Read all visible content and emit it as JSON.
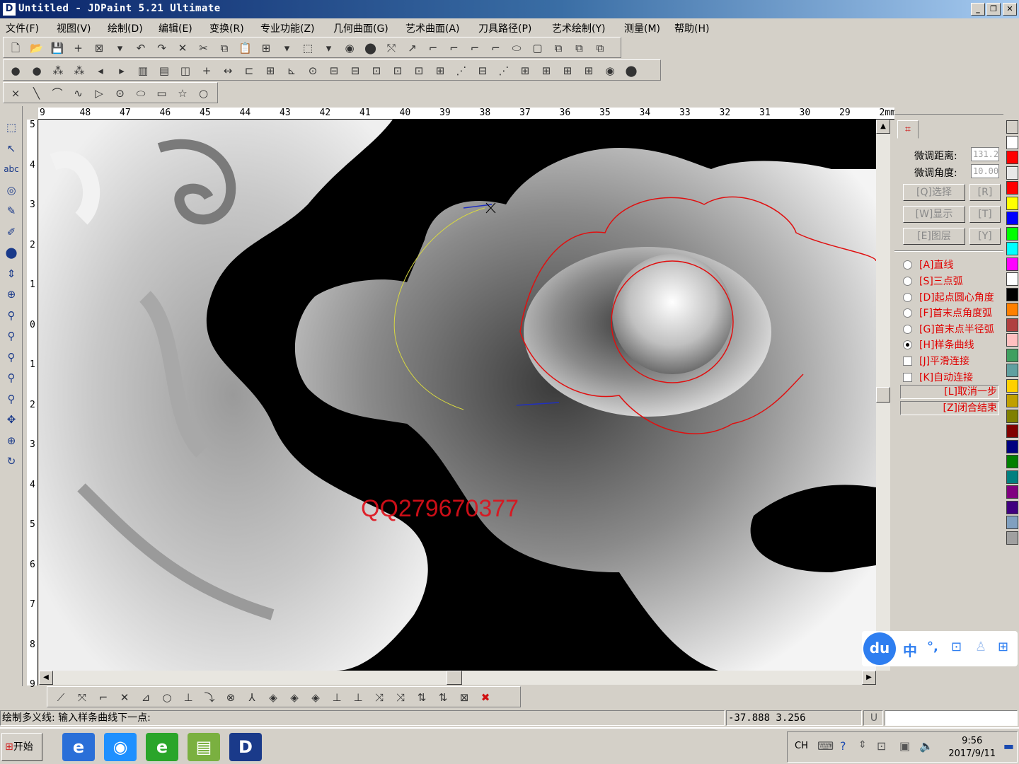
{
  "window": {
    "title": "Untitled - JDPaint 5.21 Ultimate",
    "app_icon": "jdpaint-logo-icon",
    "controls": [
      "minimize-icon",
      "restore-icon",
      "close-icon"
    ],
    "minimize": "_",
    "restore": "❐",
    "close": "✕"
  },
  "menu": [
    "文件(F)",
    "视图(V)",
    "绘制(D)",
    "编辑(E)",
    "变换(R)",
    "专业功能(Z)",
    "几何曲面(G)",
    "艺术曲面(A)",
    "刀具路径(P)",
    "艺术绘制(Y)",
    "测量(M)",
    "帮助(H)"
  ],
  "toolbar1": [
    "🗋",
    "📂",
    "💾",
    "+",
    "⊠",
    "▾",
    "↶",
    "↷",
    "✕",
    "✂",
    "⧉",
    "📋",
    "⊞",
    "▾",
    "⬚",
    "▾",
    "◉",
    "⬤",
    "⤲",
    "↗",
    "⌐",
    "⌐",
    "⌐",
    "⌐",
    "⬭",
    "▢",
    "⧉",
    "⧉",
    "⧉"
  ],
  "toolbar2": [
    "●",
    "●",
    "⁂",
    "⁂",
    "◂",
    "▸",
    "▥",
    "▤",
    "◫",
    "+",
    "↔",
    "⊏",
    "⊞",
    "⊾",
    "⊙",
    "⊟",
    "⊟",
    "⊡",
    "⊡",
    "⊡",
    "⊞",
    "⋰",
    "⊟",
    "⋰",
    "⊞",
    "⊞",
    "⊞",
    "⊞",
    "◉",
    "⬤"
  ],
  "toolbar3": [
    "×",
    "╲",
    "⌒",
    "∿",
    "▷",
    "⊙",
    "⬭",
    "▭",
    "☆",
    "○"
  ],
  "left_tools": [
    "⬚",
    "↖",
    "abc",
    "◎",
    "✎",
    "✐",
    "⬤",
    "⇕",
    "⊕",
    "⚲",
    "⚲",
    "⚲",
    "⚲",
    "⚲",
    "✥",
    "⊕",
    "↻"
  ],
  "ruler": {
    "h_labels": [
      "9",
      "48",
      "47",
      "46",
      "45",
      "44",
      "43",
      "42",
      "41",
      "40",
      "39",
      "38",
      "37",
      "36",
      "35",
      "34",
      "33",
      "32",
      "31",
      "30",
      "29",
      "2mm"
    ],
    "v_labels": [
      "5",
      "4",
      "3",
      "2",
      "1",
      "0",
      "1",
      "2",
      "3",
      "4",
      "5",
      "6",
      "7",
      "8",
      "9"
    ]
  },
  "canvas": {
    "watermark": "QQ279670377",
    "curve_color": "#e01010",
    "preview_color": "#d8d840",
    "pending_color": "#2030c0"
  },
  "panel": {
    "tab_icon": "select-tool-icon",
    "fine_distance_label": "微调距离:",
    "fine_distance_value": "131.2",
    "fine_angle_label": "微调角度:",
    "fine_angle_value": "10.00",
    "buttons": [
      {
        "label": "[Q]选择",
        "key": "[R]"
      },
      {
        "label": "[W]显示",
        "key": "[T]"
      },
      {
        "label": "[E]图层",
        "key": "[Y]"
      }
    ],
    "options": [
      {
        "label": "[A]直线",
        "type": "radio",
        "checked": false
      },
      {
        "label": "[S]三点弧",
        "type": "radio",
        "checked": false
      },
      {
        "label": "[D]起点圆心角度",
        "type": "radio",
        "checked": false
      },
      {
        "label": "[F]首末点角度弧",
        "type": "radio",
        "checked": false
      },
      {
        "label": "[G]首末点半径弧",
        "type": "radio",
        "checked": false
      },
      {
        "label": "[H]样条曲线",
        "type": "radio",
        "checked": true
      },
      {
        "label": "[J]平滑连接",
        "type": "checkbox",
        "checked": false
      },
      {
        "label": "[K]自动连接",
        "type": "checkbox",
        "checked": false
      }
    ],
    "commands": [
      "[L]取消一步",
      "[Z]闭合结束"
    ]
  },
  "palette": [
    "#d4d0c8",
    "#ffffff",
    "#ff0000",
    "#e8e8e8",
    "#ff0000",
    "#ffff00",
    "#0000ff",
    "#00ff00",
    "#00ffff",
    "#ff00ff",
    "#ffffff",
    "#000000",
    "#ff8000",
    "#b04040",
    "#ffc0c0",
    "#40a060",
    "#60a0a0",
    "#ffd000",
    "#c0a000",
    "#808000",
    "#800000",
    "#000080",
    "#008000",
    "#008080",
    "#800080",
    "#400080",
    "#80a0c0",
    "#a0a0a0"
  ],
  "bottom_tools": [
    "⟋",
    "⤧",
    "⌐",
    "✕",
    "⊿",
    "○",
    "⊥",
    "⤵",
    "⊗",
    "⅄",
    "◈",
    "◈",
    "◈",
    "⊥",
    "⊥",
    "⤨",
    "⤨",
    "⇅",
    "⇅",
    "⊠",
    "✖"
  ],
  "status": {
    "message": "绘制多义线: 输入样条曲线下一点:",
    "coords": "-37.888 3.256",
    "unit_flag": "U"
  },
  "taskbar": {
    "start_label": "开始",
    "apps": [
      {
        "icon": "ie-icon",
        "glyph": "e",
        "color": "#2a6fd8"
      },
      {
        "icon": "qq-browser-icon",
        "glyph": "◉",
        "color": "#1e90ff"
      },
      {
        "icon": "green-browser-icon",
        "glyph": "e",
        "color": "#2aa52a"
      },
      {
        "icon": "folder-icon",
        "glyph": "▤",
        "color": "#7ab040"
      },
      {
        "icon": "jdpaint-taskbar-icon",
        "glyph": "D",
        "color": "#1a3a8a"
      }
    ],
    "lang": "CH",
    "time": "9:56",
    "date": "2017/9/11"
  },
  "ime": {
    "logo": "du",
    "lang": "中",
    "items": [
      "°,",
      "⊡",
      "♙",
      "⊞"
    ]
  }
}
